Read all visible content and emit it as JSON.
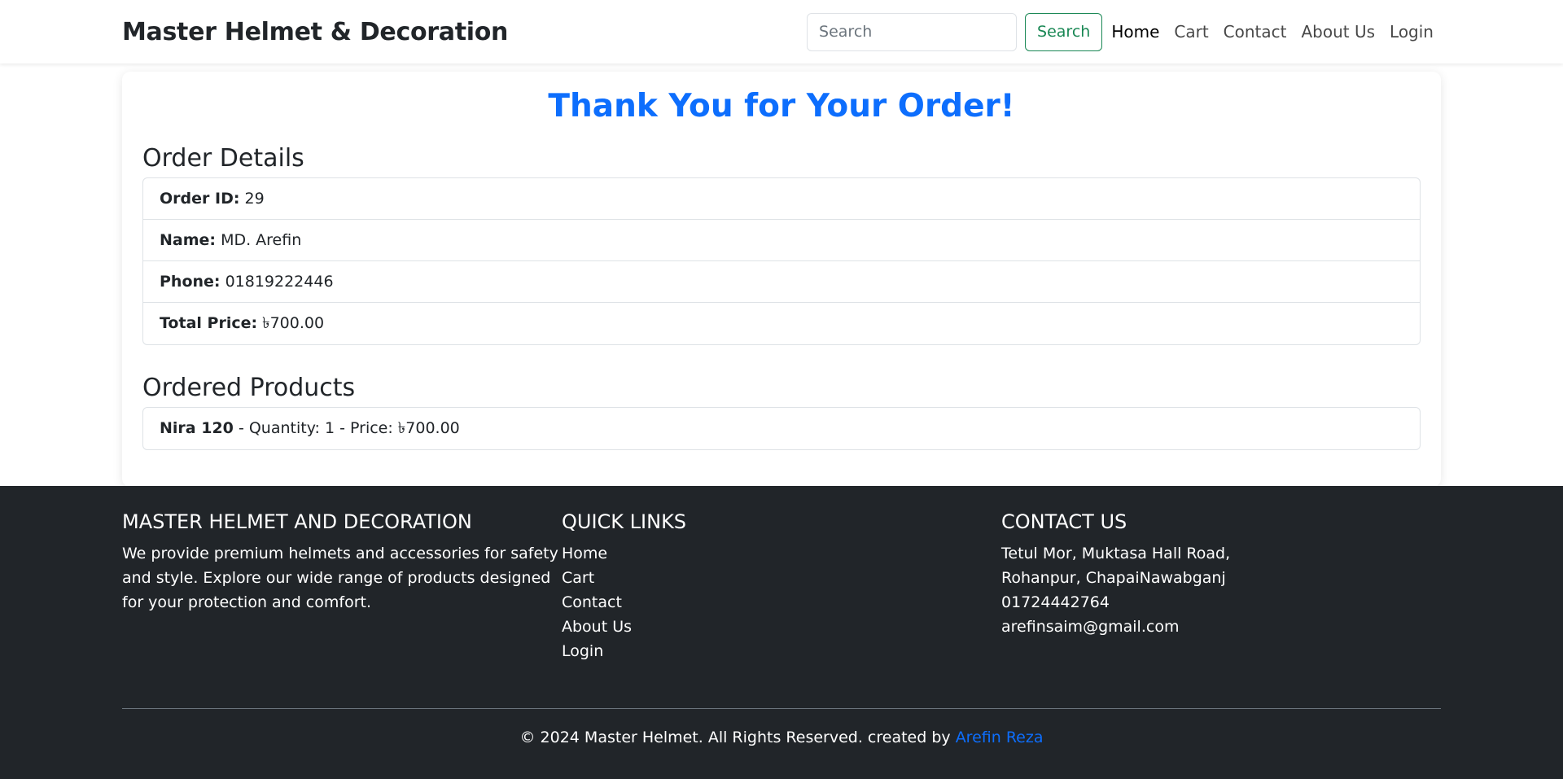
{
  "navbar": {
    "brand": "Master Helmet & Decoration",
    "search_placeholder": "Search",
    "search_button": "Search",
    "links": [
      "Home",
      "Cart",
      "Contact",
      "About Us",
      "Login"
    ]
  },
  "order": {
    "title": "Thank You for Your Order!",
    "details_heading": "Order Details",
    "fields": [
      {
        "label": "Order ID:",
        "value": "29"
      },
      {
        "label": "Name:",
        "value": "MD. Arefin"
      },
      {
        "label": "Phone:",
        "value": "01819222446"
      },
      {
        "label": "Total Price:",
        "value": "৳700.00"
      }
    ],
    "products_heading": "Ordered Products",
    "products": [
      {
        "name": "Nira 120",
        "detail": "- Quantity: 1 - Price: ৳700.00"
      }
    ]
  },
  "footer": {
    "about_heading": "MASTER HELMET AND DECORATION",
    "about_text": "We provide premium helmets and accessories for safety and style. Explore our wide range of products designed for your protection and comfort.",
    "links_heading": "QUICK LINKS",
    "links": [
      "Home",
      "Cart",
      "Contact",
      "About Us",
      "Login"
    ],
    "contact_heading": "CONTACT US",
    "address": "Tetul Mor, Muktasa Hall Road, Rohanpur, ChapaiNawabganj",
    "phone": "01724442764",
    "email": "arefinsaim@gmail.com",
    "copyright": "© 2024 Master Helmet. All Rights Reserved. created by",
    "author": "Arefin Reza"
  },
  "colors": {
    "primary": "#0d6efd",
    "success": "#198754",
    "footer_bg": "#212529"
  }
}
